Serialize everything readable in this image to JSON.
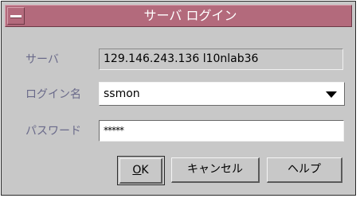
{
  "window": {
    "title": "サーバ ログイン"
  },
  "form": {
    "server_label": "サーバ",
    "server_value": "129.146.243.136 l10nlab36",
    "login_label": "ログイン名",
    "login_value": "ssmon",
    "password_label": "パスワード",
    "password_value": "*****"
  },
  "buttons": {
    "ok_mnemonic": "O",
    "ok_rest": "K",
    "cancel": "キャンセル",
    "help": "ヘルプ"
  },
  "icons": {
    "window_menu": "window-menu-icon",
    "dropdown": "chevron-down-icon"
  }
}
